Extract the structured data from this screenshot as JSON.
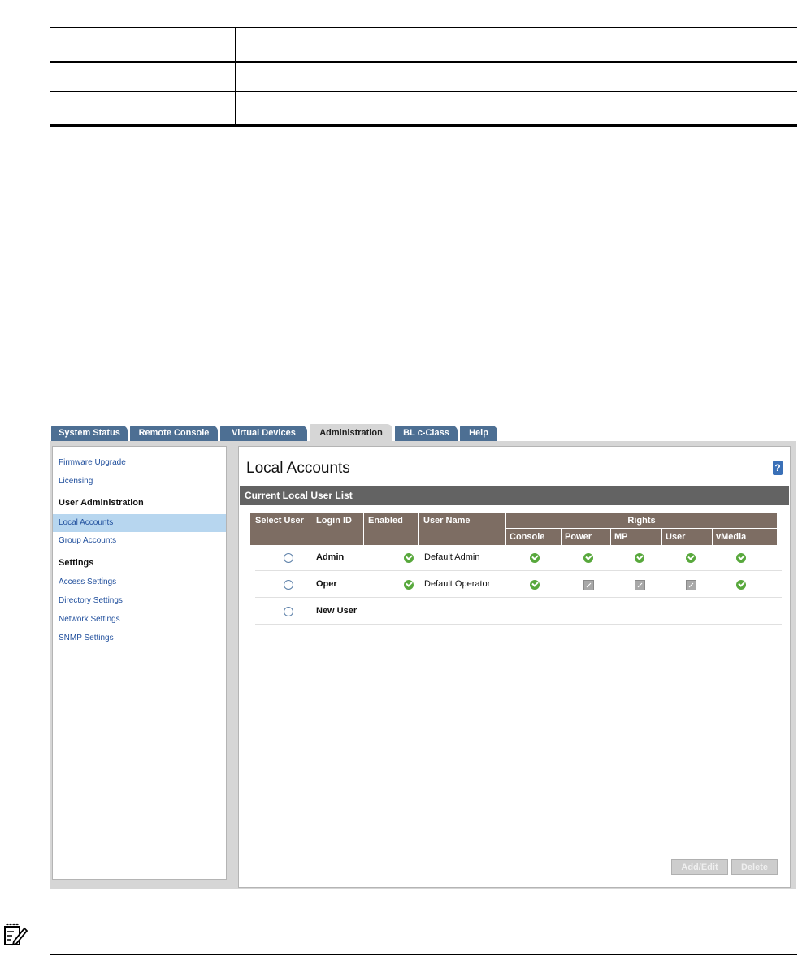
{
  "tabs": [
    "System Status",
    "Remote Console",
    "Virtual Devices",
    "Administration",
    "BL c-Class",
    "Help"
  ],
  "sidebar": {
    "links_top": [
      "Firmware Upgrade",
      "Licensing"
    ],
    "user_admin_heading": "User Administration",
    "user_admin_items": [
      "Local Accounts",
      "Group Accounts"
    ],
    "settings_heading": "Settings",
    "settings_items": [
      "Access Settings",
      "Directory Settings",
      "Network Settings",
      "SNMP Settings"
    ],
    "selected": "Local Accounts"
  },
  "main": {
    "title": "Local Accounts",
    "help_glyph": "?",
    "section_title": "Current Local User List",
    "table": {
      "headers": [
        "Select User",
        "Login ID",
        "Enabled",
        "User Name",
        "Rights"
      ],
      "rights_headers": [
        "Console",
        "Power",
        "MP",
        "User",
        "vMedia"
      ],
      "rows": [
        {
          "login": "Admin",
          "enabled": true,
          "user_name": "Default Admin",
          "rights": [
            true,
            true,
            true,
            true,
            true
          ]
        },
        {
          "login": "Oper",
          "enabled": true,
          "user_name": "Default Operator",
          "rights": [
            true,
            false,
            false,
            false,
            true
          ]
        },
        {
          "login": "New User",
          "enabled": null,
          "user_name": "",
          "rights": []
        }
      ]
    },
    "buttons": {
      "add_edit": "Add/Edit",
      "delete": "Delete"
    }
  },
  "colors": {
    "tab": "#4d6f93",
    "section_bar": "#636363",
    "header": "#7d6d63",
    "check": "#58a83c",
    "link": "#1f4e9c"
  },
  "note_icon": "note-pad-icon"
}
